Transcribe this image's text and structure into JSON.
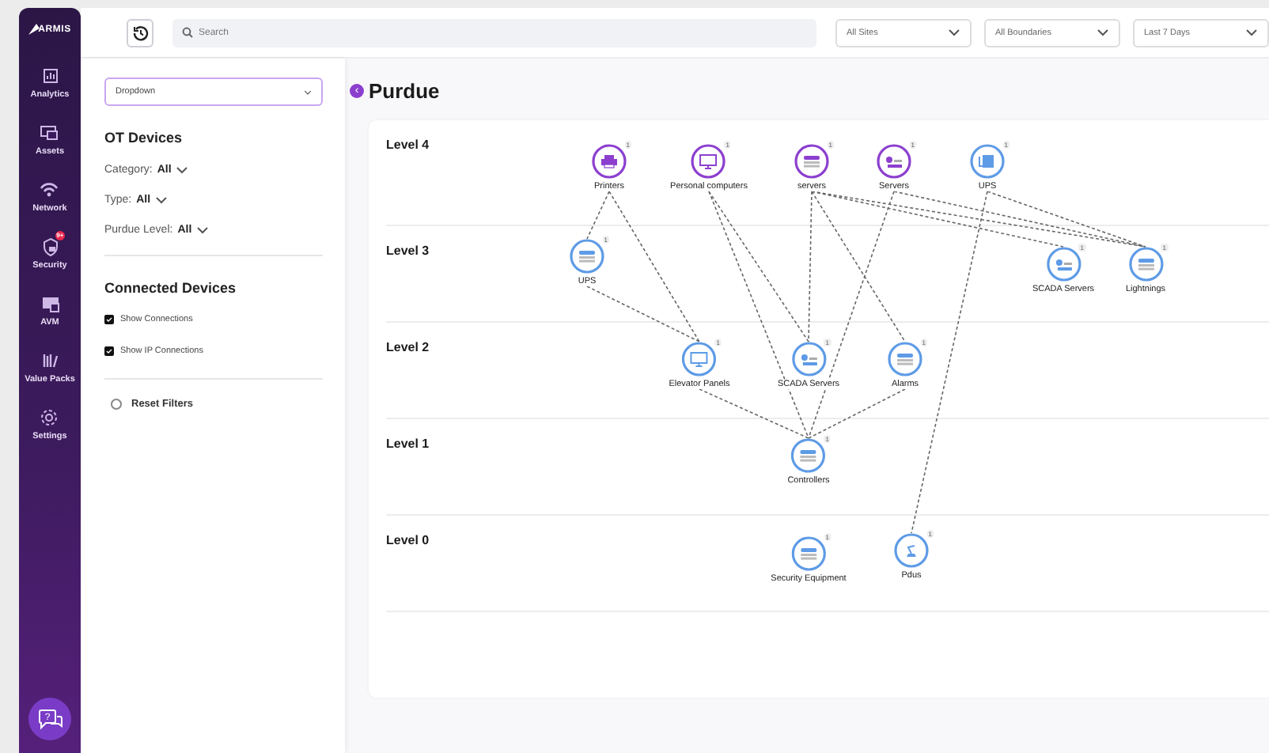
{
  "nav": {
    "logo": "ARMIS",
    "items": [
      {
        "label": "Analytics"
      },
      {
        "label": "Assets"
      },
      {
        "label": "Network"
      },
      {
        "label": "Security",
        "badge": "9+"
      },
      {
        "label": "AVM"
      },
      {
        "label": "Value Packs"
      },
      {
        "label": "Settings"
      }
    ],
    "help_mark": "?"
  },
  "topbar": {
    "search": {
      "placeholder": "Search"
    },
    "dropdowns": [
      "All Sites",
      "All Boundaries",
      "Last 7 Days"
    ]
  },
  "filters": {
    "dropdown": "Dropdown",
    "collapse_button": "‹",
    "ot_title": "OT Devices",
    "selects": [
      {
        "label": "Category:",
        "value": "All"
      },
      {
        "label": "Type:",
        "value": "All"
      },
      {
        "label": "Purdue Level:",
        "value": "All"
      }
    ],
    "connected_title": "Connected Devices",
    "checkboxes": [
      {
        "label": "Show Connections",
        "checked": true
      },
      {
        "label": "Show IP Connections",
        "checked": true
      }
    ],
    "reset": {
      "label": "Reset Filters",
      "selected": false
    }
  },
  "page_title": "Purdue",
  "levels": [
    {
      "label": "Level 4",
      "nodes": [
        {
          "label": "Printers",
          "count": "1",
          "color": "#8c3fcf"
        },
        {
          "label": "Personal computers",
          "count": "1",
          "color": "#8c3fcf"
        },
        {
          "label": "servers",
          "count": "1",
          "color": "#8c3fcf"
        },
        {
          "label": "Servers",
          "count": "1",
          "color": "#8c3fcf"
        },
        {
          "label": "UPS",
          "count": "1",
          "color": "#5e9be6"
        }
      ]
    },
    {
      "label": "Level 3",
      "nodes": [
        {
          "label": "UPS",
          "count": "1",
          "color": "#5e9be6"
        },
        {
          "label": "SCADA Servers",
          "count": "1",
          "color": "#5e9be6"
        },
        {
          "label": "Lightnings",
          "count": "1",
          "color": "#5e9be6"
        }
      ]
    },
    {
      "label": "Level 2",
      "nodes": [
        {
          "label": "Elevator Panels",
          "count": "1",
          "color": "#5e9be6"
        },
        {
          "label": "SCADA Servers",
          "count": "1",
          "color": "#5e9be6"
        },
        {
          "label": "Alarms",
          "count": "1",
          "color": "#5e9be6"
        }
      ]
    },
    {
      "label": "Level 1",
      "nodes": [
        {
          "label": "Controllers",
          "count": "1",
          "color": "#5e9be6"
        }
      ]
    },
    {
      "label": "Level 0",
      "nodes": [
        {
          "label": "Security Equipment",
          "count": "1",
          "color": "#5e9be6"
        },
        {
          "label": "Pdus",
          "count": "1",
          "color": "#5e9be6"
        }
      ]
    }
  ]
}
